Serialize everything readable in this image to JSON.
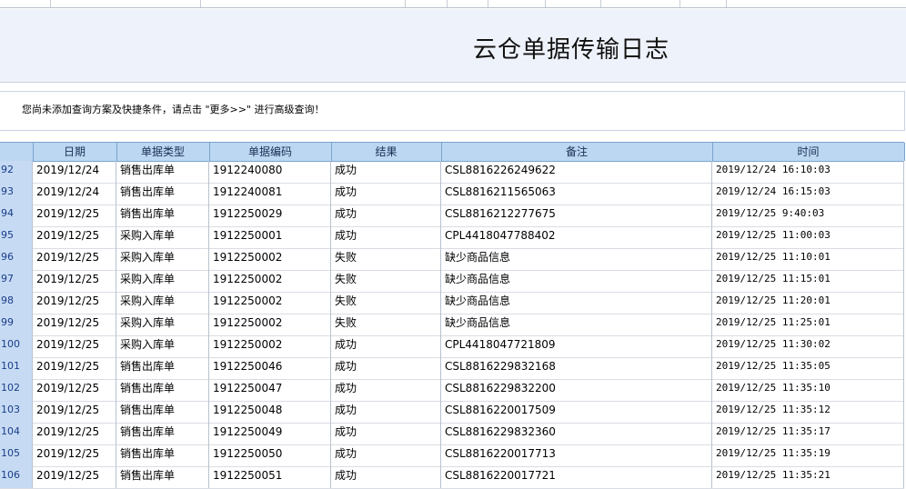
{
  "page": {
    "title": "云仓单据传输日志"
  },
  "notice": {
    "text": "您尚未添加查询方案及快捷条件，请点击 \"更多>>\" 进行高级查询！"
  },
  "columns": {
    "date": "日期",
    "type": "单据类型",
    "code": "单据编码",
    "result": "结果",
    "remark": "备注",
    "time": "时间"
  },
  "rows": [
    {
      "no": "92",
      "date": "2019/12/24",
      "type": "销售出库单",
      "code": "1912240080",
      "result": "成功",
      "remark": "CSL8816226249622",
      "time": "2019/12/24 16:10:03"
    },
    {
      "no": "93",
      "date": "2019/12/24",
      "type": "销售出库单",
      "code": "1912240081",
      "result": "成功",
      "remark": "CSL8816211565063",
      "time": "2019/12/24 16:15:03"
    },
    {
      "no": "94",
      "date": "2019/12/25",
      "type": "销售出库单",
      "code": "1912250029",
      "result": "成功",
      "remark": "CSL8816212277675",
      "time": "2019/12/25 9:40:03"
    },
    {
      "no": "95",
      "date": "2019/12/25",
      "type": "采购入库单",
      "code": "1912250001",
      "result": "成功",
      "remark": "CPL4418047788402",
      "time": "2019/12/25 11:00:03"
    },
    {
      "no": "96",
      "date": "2019/12/25",
      "type": "采购入库单",
      "code": "1912250002",
      "result": "失败",
      "remark": "缺少商品信息",
      "time": "2019/12/25 11:10:01"
    },
    {
      "no": "97",
      "date": "2019/12/25",
      "type": "采购入库单",
      "code": "1912250002",
      "result": "失败",
      "remark": "缺少商品信息",
      "time": "2019/12/25 11:15:01"
    },
    {
      "no": "98",
      "date": "2019/12/25",
      "type": "采购入库单",
      "code": "1912250002",
      "result": "失败",
      "remark": "缺少商品信息",
      "time": "2019/12/25 11:20:01"
    },
    {
      "no": "99",
      "date": "2019/12/25",
      "type": "采购入库单",
      "code": "1912250002",
      "result": "失败",
      "remark": "缺少商品信息",
      "time": "2019/12/25 11:25:01"
    },
    {
      "no": "100",
      "date": "2019/12/25",
      "type": "采购入库单",
      "code": "1912250002",
      "result": "成功",
      "remark": "CPL4418047721809",
      "time": "2019/12/25 11:30:02"
    },
    {
      "no": "101",
      "date": "2019/12/25",
      "type": "销售出库单",
      "code": "1912250046",
      "result": "成功",
      "remark": "CSL8816229832168",
      "time": "2019/12/25 11:35:05"
    },
    {
      "no": "102",
      "date": "2019/12/25",
      "type": "销售出库单",
      "code": "1912250047",
      "result": "成功",
      "remark": "CSL8816229832200",
      "time": "2019/12/25 11:35:10"
    },
    {
      "no": "103",
      "date": "2019/12/25",
      "type": "销售出库单",
      "code": "1912250048",
      "result": "成功",
      "remark": "CSL8816220017509",
      "time": "2019/12/25 11:35:12"
    },
    {
      "no": "104",
      "date": "2019/12/25",
      "type": "销售出库单",
      "code": "1912250049",
      "result": "成功",
      "remark": "CSL8816229832360",
      "time": "2019/12/25 11:35:17"
    },
    {
      "no": "105",
      "date": "2019/12/25",
      "type": "销售出库单",
      "code": "1912250050",
      "result": "成功",
      "remark": "CSL8816220017713",
      "time": "2019/12/25 11:35:19"
    },
    {
      "no": "106",
      "date": "2019/12/25",
      "type": "销售出库单",
      "code": "1912250051",
      "result": "成功",
      "remark": "CSL8816220017721",
      "time": "2019/12/25 11:35:21"
    }
  ]
}
